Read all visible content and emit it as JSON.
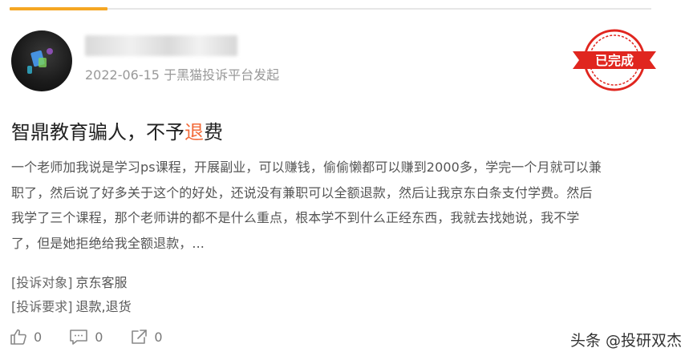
{
  "header": {
    "meta_text": "2022-06-15 于黑猫投诉平台发起",
    "stamp_text": "已完成"
  },
  "complaint": {
    "title_part1": "智鼎教育骗人，不予",
    "title_highlight": "退",
    "title_part2": "费",
    "content_lines": [
      "一个老师加我说是学习ps课程，开展副业，可以赚钱，偷偷懒都可以赚到2000多，学完一个月就可以兼",
      "职了，然后说了好多关于这个的好处，还说没有兼职可以全额退款，然后让我京东白条支付学费。然后",
      "我学了三个课程，那个老师讲的都不是什么重点，根本学不到什么正经东西，我就去找她说，我不学",
      "了，但是她拒绝给我全额退款，..."
    ],
    "target_label": "[投诉对象]",
    "target_value": "京东客服",
    "demand_label": "[投诉要求]",
    "demand_value": "退款,退货"
  },
  "actions": {
    "like_count": "0",
    "comment_count": "0",
    "share_count": "0"
  },
  "watermark": "头条 @投研双杰",
  "colors": {
    "accent_orange": "#f5a623",
    "highlight": "#f26b3a",
    "stamp_red": "#e0261f"
  }
}
